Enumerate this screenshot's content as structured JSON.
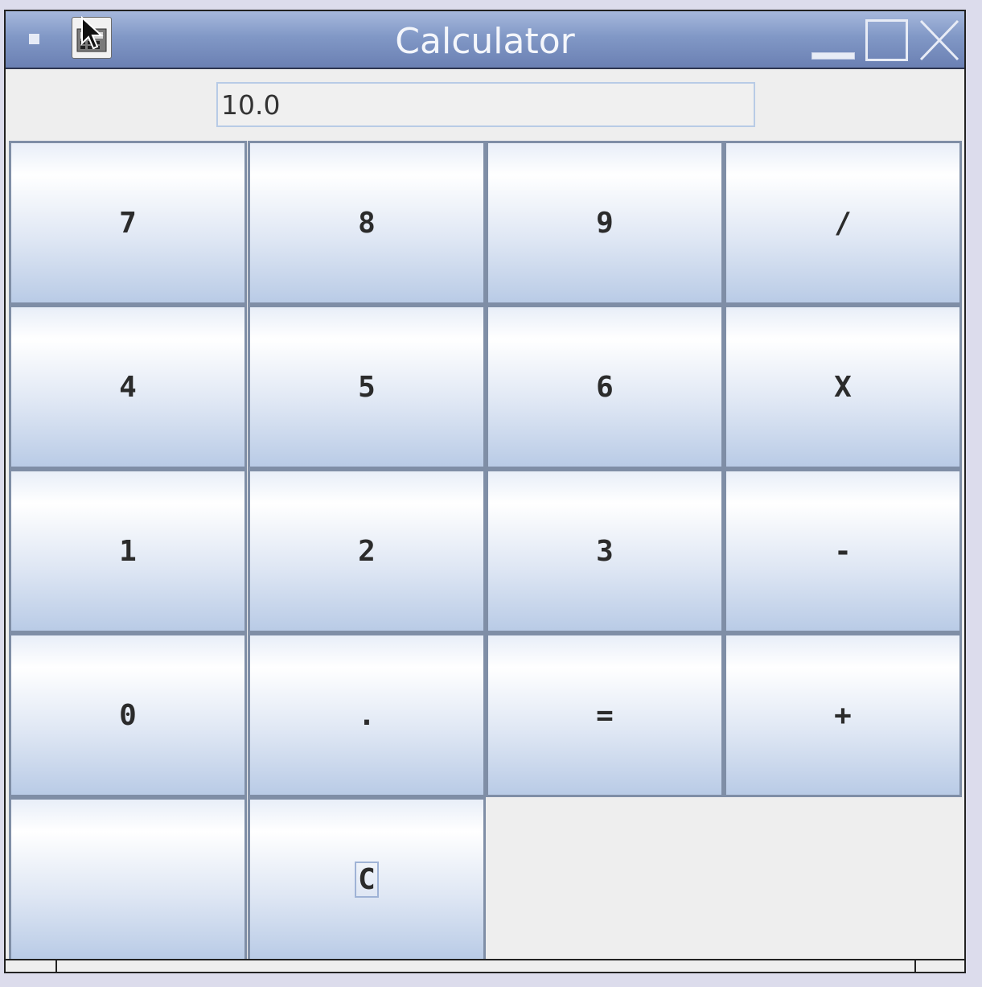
{
  "window": {
    "title": "Calculator"
  },
  "display": {
    "value": "10.0"
  },
  "keypad": {
    "rows": [
      [
        "7",
        "8",
        "9",
        "/"
      ],
      [
        "4",
        "5",
        "6",
        "X"
      ],
      [
        "1",
        "2",
        "3",
        "-"
      ],
      [
        "0",
        ".",
        "=",
        "+"
      ],
      [
        "",
        "C"
      ]
    ]
  },
  "colors": {
    "titlebar": "#8198c6",
    "button_top": "#ffffff",
    "button_bottom": "#b9cbe6",
    "button_border": "#7f8ea6",
    "window_bg": "#eeeeee"
  },
  "icons": {
    "system_menu": "square-icon",
    "app": "app-icon",
    "minimize": "minimize-icon",
    "maximize": "maximize-icon",
    "close": "close-icon"
  }
}
